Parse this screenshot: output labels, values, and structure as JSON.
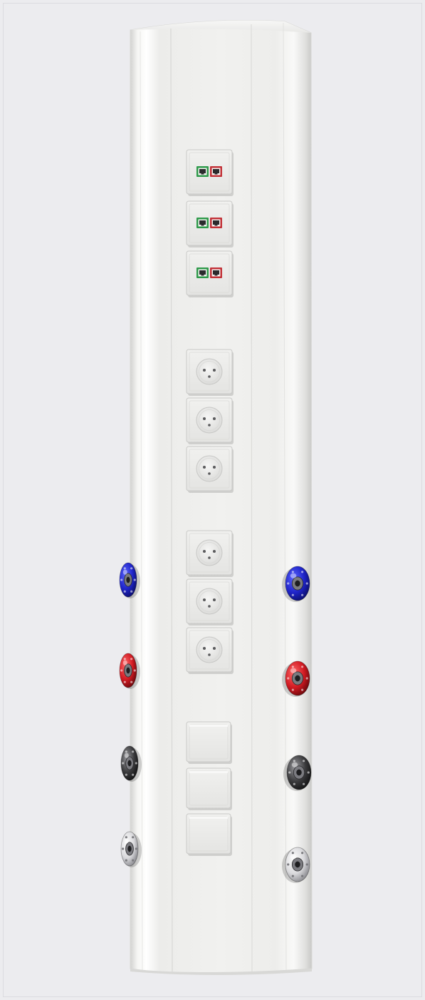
{
  "scene": {
    "subject": "medical-supply-column",
    "background_color": "#ececef",
    "column_color": "#f3f3f1",
    "module_color": "#eeeeec",
    "colors": {
      "rj45_green": "#2f9a4b",
      "rj45_red": "#c23238",
      "gas_blue": "#1f24c8",
      "gas_red": "#d11a22",
      "gas_black": "#3a3a3c",
      "gas_chrome": "#d9d9dc"
    }
  },
  "network_modules": [
    {
      "ports": [
        {
          "color": "green"
        },
        {
          "color": "red"
        }
      ]
    },
    {
      "ports": [
        {
          "color": "green"
        },
        {
          "color": "red"
        }
      ]
    },
    {
      "ports": [
        {
          "color": "green"
        },
        {
          "color": "red"
        }
      ]
    }
  ],
  "power_socket_groups": [
    {
      "sockets": 3,
      "type": "3-pin"
    },
    {
      "sockets": 3,
      "type": "3-pin"
    }
  ],
  "blank_plates": 3,
  "gas_outlets": [
    {
      "side": "left",
      "color": "blue"
    },
    {
      "side": "right",
      "color": "blue"
    },
    {
      "side": "left",
      "color": "red"
    },
    {
      "side": "right",
      "color": "red"
    },
    {
      "side": "left",
      "color": "black"
    },
    {
      "side": "right",
      "color": "black"
    },
    {
      "side": "left",
      "color": "chrome"
    },
    {
      "side": "right",
      "color": "chrome"
    }
  ]
}
